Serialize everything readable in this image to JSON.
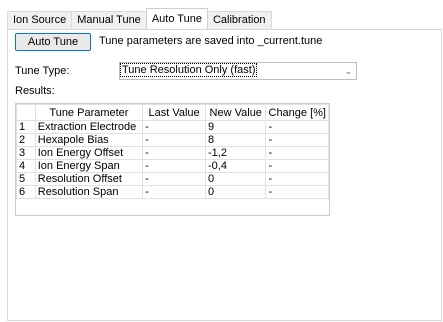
{
  "tabs": [
    {
      "label": "Ion Source",
      "active": false
    },
    {
      "label": "Manual Tune",
      "active": false
    },
    {
      "label": "Auto Tune",
      "active": true
    },
    {
      "label": "Calibration",
      "active": false
    }
  ],
  "auto_tune": {
    "button_label": "Auto Tune",
    "hint": "Tune parameters are saved into _current.tune",
    "tune_type_label": "Tune Type:",
    "tune_type_value": "Tune Resolution Only (fast)",
    "results_label": "Results:"
  },
  "results_table": {
    "columns": [
      "",
      "Tune Parameter",
      "Last Value",
      "New Value",
      "Change [%]"
    ],
    "rows": [
      [
        "1",
        "Extraction Electrode",
        "-",
        "9",
        "-"
      ],
      [
        "2",
        "Hexapole Bias",
        "-",
        "8",
        "-"
      ],
      [
        "3",
        "Ion Energy Offset",
        "-",
        "-1,2",
        "-"
      ],
      [
        "4",
        "Ion Energy Span",
        "-",
        "-0,4",
        "-"
      ],
      [
        "5",
        "Resolution Offset",
        "-",
        "0",
        "-"
      ],
      [
        "6",
        "Resolution Span",
        "-",
        "0",
        "-"
      ]
    ]
  },
  "colors": {
    "accent_border": "#0078d7"
  }
}
